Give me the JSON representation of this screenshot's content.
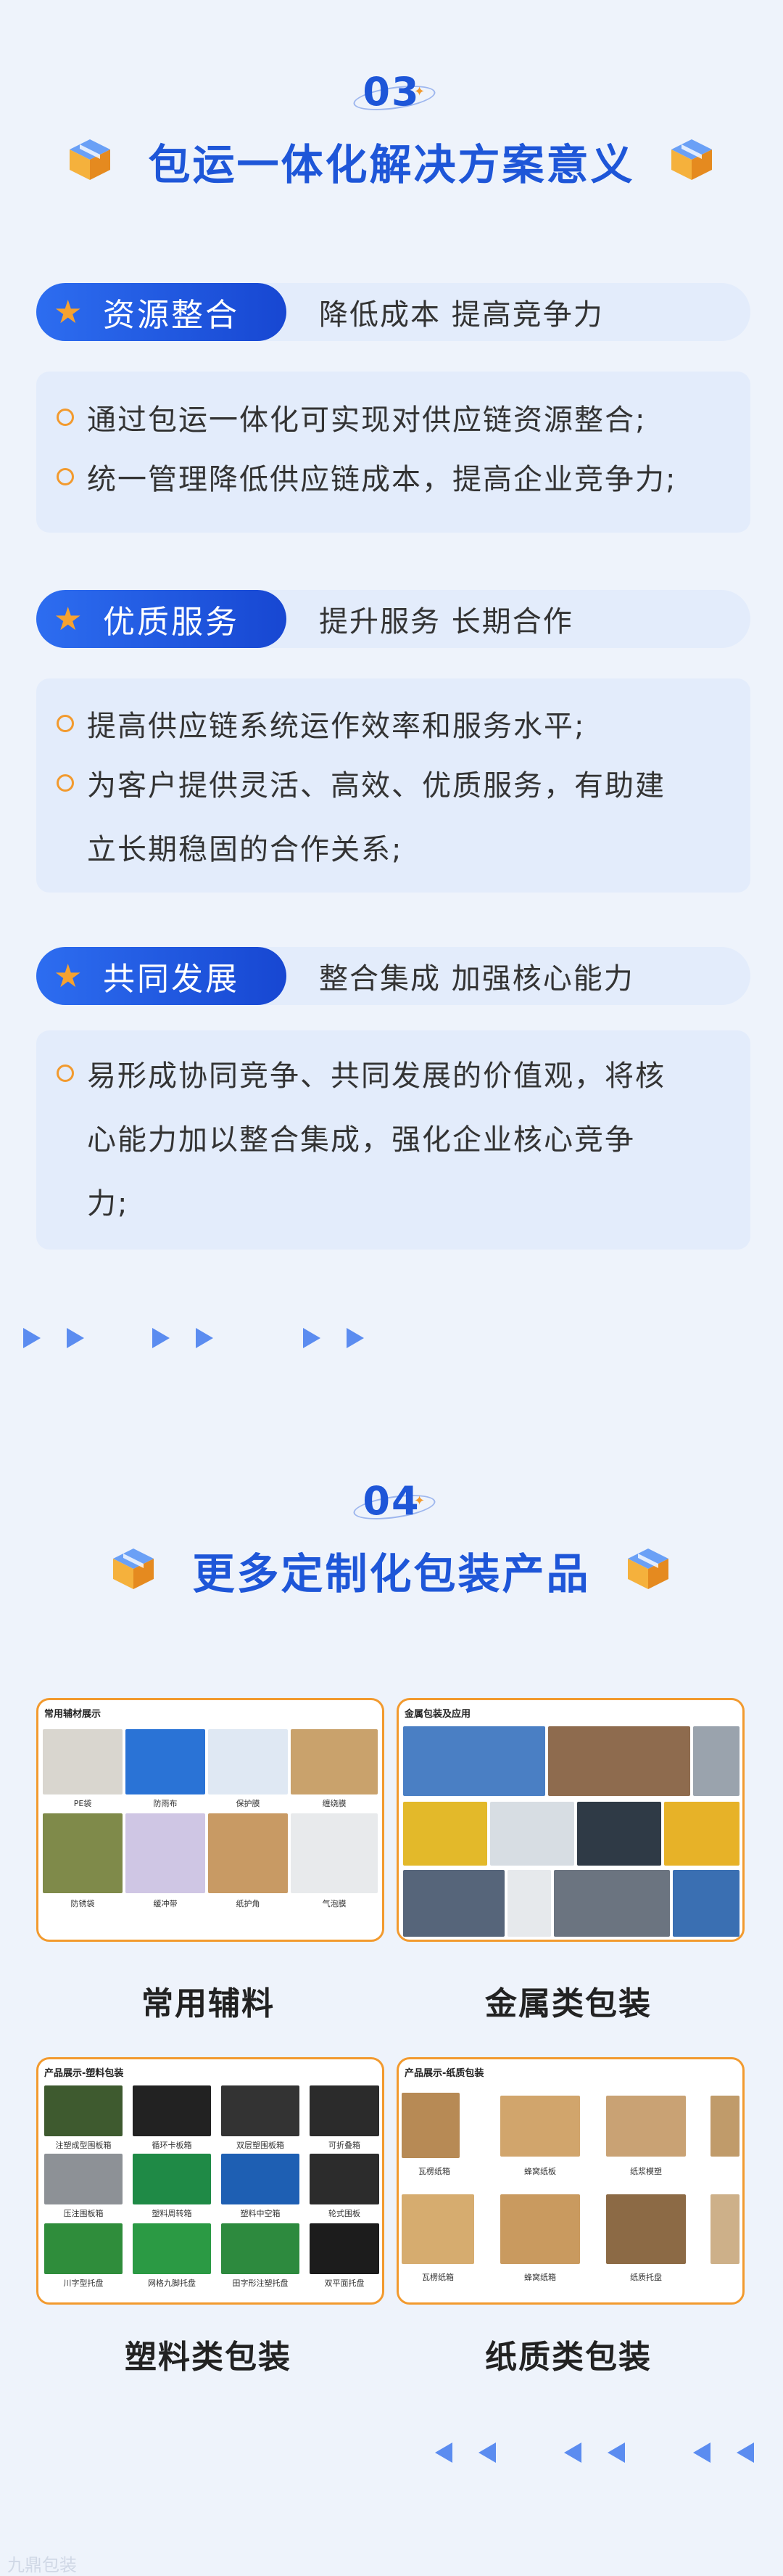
{
  "section03": {
    "number": "03",
    "title": "包运一体化解决方案意义",
    "items": [
      {
        "badge": "资源整合",
        "subtitle": "降低成本 提高竞争力",
        "lines": [
          "通过包运一体化可实现对供应链资源整合;",
          "统一管理降低供应链成本，提高企业竞争力;"
        ]
      },
      {
        "badge": "优质服务",
        "subtitle": "提升服务 长期合作",
        "lines": [
          "提高供应链系统运作效率和服务水平;",
          "为客户提供灵活、高效、优质服务，有助建",
          "立长期稳固的合作关系;"
        ]
      },
      {
        "badge": "共同发展",
        "subtitle": "整合集成 加强核心能力",
        "lines": [
          "易形成协同竞争、共同发展的价值观，将核",
          "心能力加以整合集成，强化企业核心竞争",
          "力;"
        ]
      }
    ]
  },
  "section04": {
    "number": "04",
    "title": "更多定制化包装产品",
    "products": [
      {
        "label": "常用辅料",
        "card_title": "常用辅材展示",
        "thumbs": [
          "PE袋",
          "防雨布",
          "保护膜",
          "缠绕膜",
          "防锈袋",
          "缓冲带",
          "纸护角",
          "气泡膜"
        ]
      },
      {
        "label": "金属类包装",
        "card_title": "金属包装及应用",
        "thumbs": []
      },
      {
        "label": "塑料类包装",
        "card_title": "产品展示-塑料包装",
        "thumbs": [
          "注塑成型围板箱",
          "循环卡板箱",
          "双层塑围板箱",
          "可折叠箱",
          "压注围板箱",
          "塑料周转箱",
          "塑料中空箱",
          "轮式围板",
          "川字型托盘",
          "网格九脚托盘",
          "田字形注塑托盘",
          "双平面托盘"
        ]
      },
      {
        "label": "纸质类包装",
        "card_title": "产品展示-纸质包装",
        "thumbs": [
          "瓦楞纸箱",
          "蜂窝纸板",
          "纸浆模塑",
          "瓦楞纸箱",
          "蜂窝纸箱",
          "纸质托盘"
        ]
      }
    ]
  },
  "watermark": "九鼎包装",
  "colors": {
    "primary": "#1e56d8",
    "accent": "#f29a2e",
    "card_bg": "#e3ecfb",
    "page_bg": "#eef3fb"
  },
  "icons": [
    "cube-icon",
    "star-icon",
    "arrow-right-icon",
    "arrow-left-icon"
  ]
}
